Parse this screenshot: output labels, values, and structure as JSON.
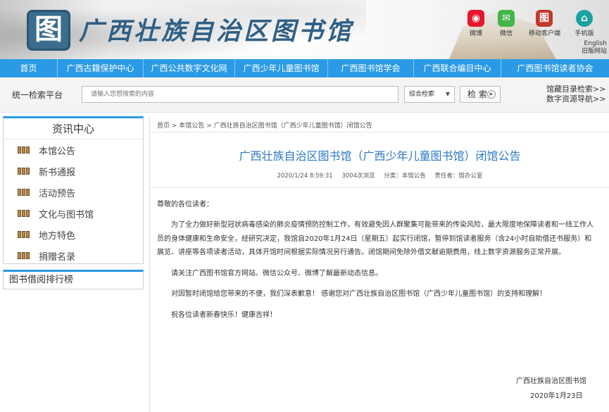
{
  "header": {
    "seal_char": "图",
    "site_title": "广西壮族自治区图书馆",
    "social": [
      {
        "label": "微博",
        "icon": "weibo-icon",
        "color": "#e6162d",
        "glyph": "◉"
      },
      {
        "label": "微信",
        "icon": "wechat-icon",
        "color": "#44b549",
        "glyph": "✉"
      },
      {
        "label": "移动客户端",
        "icon": "mobile-app-icon",
        "color": "#c0392b",
        "glyph": "图"
      },
      {
        "label": "手机版",
        "icon": "mobile-site-icon",
        "color": "#1aa1a1",
        "glyph": "⌂"
      }
    ],
    "english_link": "English",
    "old_site_link": "旧版网站"
  },
  "nav": {
    "items": [
      "首页",
      "广西古籍保护中心",
      "广西公共数字文化网",
      "广西少年儿童图书馆",
      "广西图书馆学会",
      "广西联合编目中心",
      "广西图书馆读者协会"
    ]
  },
  "search": {
    "label": "统一检索平台",
    "placeholder": "请输入您想搜索的内容",
    "scope_selected": "综合检索",
    "button": "检 索",
    "links": [
      "馆藏目录检索>>",
      "数字资源导航>>"
    ]
  },
  "sidebar": {
    "panel_title": "资讯中心",
    "items": [
      "本馆公告",
      "新书通报",
      "活动预告",
      "文化与图书馆",
      "地方特色",
      "捐赠名录"
    ],
    "rank_title": "图书借阅排行榜"
  },
  "article": {
    "breadcrumb": [
      "首页",
      "本馆公告",
      "广西壮族自治区图书馆（广西少年儿童图书馆）闭馆公告"
    ],
    "title": "广西壮族自治区图书馆（广西少年儿童图书馆）闭馆公告",
    "meta": {
      "datetime": "2020/1/24 8:59:31",
      "views": "3004次浏览",
      "category": "分类：本馆公告",
      "editor": "责任者：馆办公室"
    },
    "greeting": "尊敬的各位读者：",
    "para1": "　　为了全力做好新型冠状病毒感染的肺炎疫情预防控制工作，有效避免因人群聚集可能带来的传染风险，最大限度地保障读者和一线工作人员的身体健康和生命安全，经研究决定，我馆自2020年1月24日（星期五）起实行闭馆，暂停到馆读者服务（含24小时自助借还书服务）和展览、讲座等各项读者活动，具体开馆时间根据实际情况另行通告。闭馆期间免除外借文献逾期费用，线上数字资源服务正常开展。",
    "para2": "　　请关注广西图书馆官方网站、微信公众号、微博了解最新动态信息。",
    "para3": "　　对因暂时闭馆给您带来的不便，我们深表歉意！ 感谢您对广西壮族自治区图书馆（广西少年儿童图书馆）的支持和理解！",
    "para4": "　　祝各位读者新春快乐！健康吉祥！",
    "sign_org": "广西壮族自治区图书馆",
    "sign_date": "2020年1月23日"
  }
}
